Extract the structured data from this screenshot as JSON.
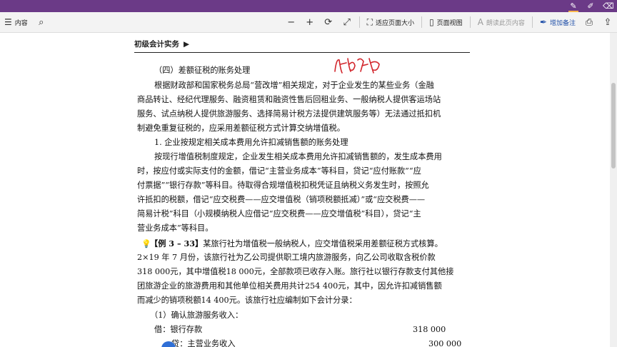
{
  "titlebar": {
    "icons": [
      "pen-icon",
      "highlighter-icon",
      "eraser-icon"
    ]
  },
  "toolbar": {
    "contents_label": "内容",
    "fit_page_label": "适应页面大小",
    "page_view_label": "页面视图",
    "read_aloud_label": "朗读此页内容",
    "add_note_label": "增加备注"
  },
  "page": {
    "header": "初级会计实务",
    "header_arrow": "▶",
    "annotation_text": "",
    "lines": [
      "（四）差额征税的账务处理",
      "根据财政部和国家税务总局“营改增”相关规定，对于企业发生的某些业务（金融",
      "商品转让、经纪代理服务、融资租赁和融资性售后回租业务、一般纳税人提供客运场站",
      "服务、试点纳税人提供旅游服务、选择简易计税方法提供建筑服务等）无法通过抵扣机",
      "制避免重复征税的，应采用差额征税方式计算交纳增值税。",
      "1. 企业按规定相关成本费用允许扣减销售额的账务处理",
      "按现行增值税制度规定，企业发生相关成本费用允许扣减销售额的，发生成本费用",
      "时，按应付或实际支付的金额，借记“主营业务成本”等科目，贷记“应付账款”“应",
      "付票据”“银行存款”等科目。待取得合规增值税扣税凭证且纳税义务发生时，按照允",
      "许抵扣的税额，借记“应交税费——应交增值税（销项税额抵减）”或“应交税费——",
      "简易计税”科目（小规模纳税人应借记“应交税费——应交增值税”科目），贷记“主",
      "营业务成本”等科目。"
    ],
    "example_title": "【例 3 – 33】",
    "example_lines": [
      "某旅行社为增值税一般纳税人，应交增值税采用差额征税方式核算。",
      "2×19 年 7 月份，该旅行社为乙公司提供职工境内旅游服务，向乙公司收取含税价款",
      "318 000元，其中增值税18 000元，全部款项已收存入账。旅行社以银行存款支付其他接",
      "团旅游企业的旅游费用和其他单位相关费用共计254 400元，其中，因允许扣减销售额",
      "而减少的销项税额14 400元。该旅行社应编制如下会计分录："
    ],
    "entry": {
      "step": "（1）确认旅游服务收入：",
      "debit_label": "借：银行存款",
      "debit_amount": "318 000",
      "credit_label": "贷：主营业务收入",
      "credit_amount": "300 000"
    }
  }
}
